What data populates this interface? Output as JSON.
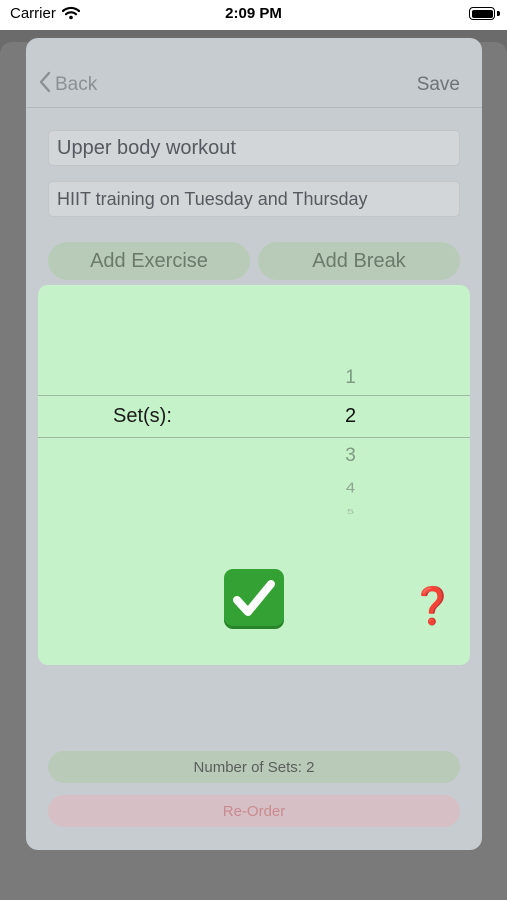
{
  "status_bar": {
    "carrier": "Carrier",
    "time": "2:09 PM",
    "icons": [
      "wifi-icon",
      "battery-icon"
    ]
  },
  "nav": {
    "back_label": "Back",
    "save_label": "Save"
  },
  "form": {
    "title_value": "Upper body workout",
    "description_value": "HIIT training on Tuesday and Thursday"
  },
  "actions": {
    "add_exercise": "Add Exercise",
    "add_break": "Add Break"
  },
  "picker": {
    "label": "Set(s):",
    "options": [
      "1",
      "2",
      "3",
      "4",
      "5"
    ],
    "selected": "2",
    "confirm_icon": "check-mark-button-icon",
    "help_icon": "question-mark-icon",
    "help_text": "❓"
  },
  "footer": {
    "number_of_sets": "Number of Sets: 2",
    "reorder": "Re-Order"
  },
  "colors": {
    "picker_background": "#c5f2c8",
    "confirm_green": "#33a133",
    "help_red": "#c8181e",
    "reorder_text": "#c98b8f"
  }
}
